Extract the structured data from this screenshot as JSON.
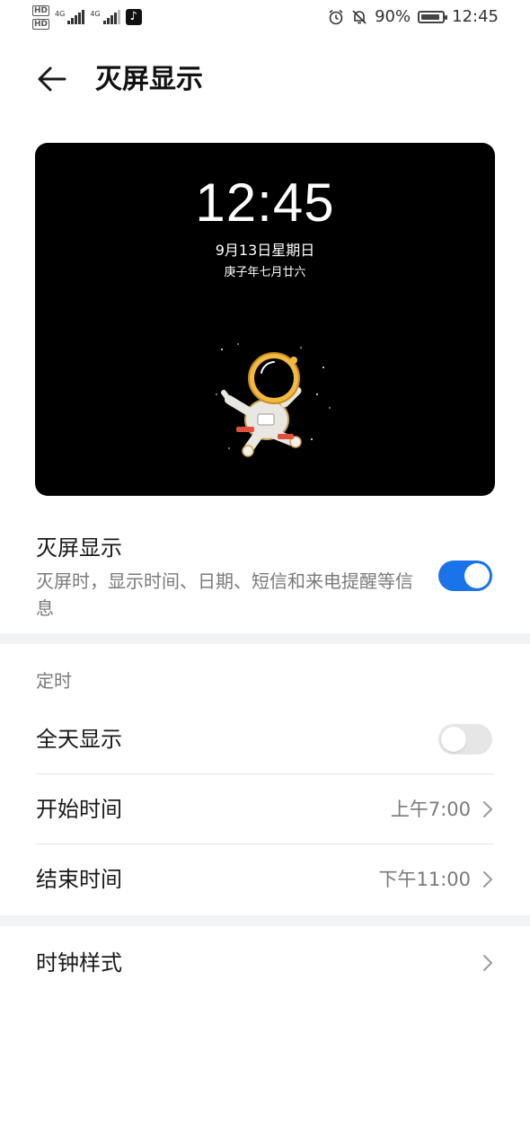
{
  "status_bar": {
    "hd1": "HD",
    "hd2": "HD",
    "net1": "4G",
    "net2": "4G",
    "battery_percent": "90%",
    "battery_level": 0.9,
    "time": "12:45",
    "icons": [
      "hd-icon",
      "signal-icon",
      "tiktok-icon",
      "alarm-icon",
      "mute-icon",
      "battery-icon"
    ]
  },
  "header": {
    "title": "灭屏显示",
    "back_icon": "back-arrow-icon"
  },
  "preview": {
    "time": "12:45",
    "date": "9月13日星期日",
    "lunar": "庚子年七月廿六",
    "bg": "#000000"
  },
  "aod": {
    "title": "灭屏显示",
    "subtitle": "灭屏时，显示时间、日期、短信和来电提醒等信息",
    "enabled": true,
    "accent": "#1a73e8"
  },
  "schedule": {
    "section_label": "定时",
    "all_day": {
      "label": "全天显示",
      "enabled": false
    },
    "start": {
      "label": "开始时间",
      "value": "上午7:00"
    },
    "end": {
      "label": "结束时间",
      "value": "下午11:00"
    }
  },
  "clock_style": {
    "label": "时钟样式"
  }
}
